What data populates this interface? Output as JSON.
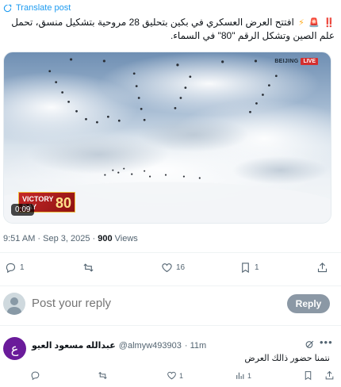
{
  "translate": {
    "label": "Translate post",
    "icon": "translate-icon"
  },
  "post": {
    "emoji_alert": "‼️",
    "text": "افتتح العرض العسكري في بكين بتحليق 28 مروحية بتشكيل منسق، تحمل علم الصين وتشكل الرقم \"80\" في السماء."
  },
  "media": {
    "logo_city": "BEIJING",
    "logo_live": "LIVE",
    "victory_line1": "VICTORY",
    "victory_line2": "DAY",
    "victory_num": "80",
    "duration": "0:09",
    "colors": {
      "live": "#d32f2f",
      "banner": "#c62828"
    }
  },
  "meta": {
    "time": "9:51 AM · Sep 3, 2025 · ",
    "views_count": "900",
    "views_label": " Views"
  },
  "actions": {
    "replies": "1",
    "reposts": "",
    "likes": "16",
    "bookmarks": "1"
  },
  "reply_box": {
    "placeholder": "Post your reply",
    "button": "Reply"
  },
  "comment": {
    "avatar_letter": "ع",
    "name": "عبدالله مسعود العيو",
    "handle": "@almyw493903",
    "time": "· 11m",
    "text": "نتمنا حضور ذالك العرض",
    "replies": "",
    "reposts": "",
    "likes": "1",
    "views": "1"
  },
  "accent": "#1d9bf0"
}
